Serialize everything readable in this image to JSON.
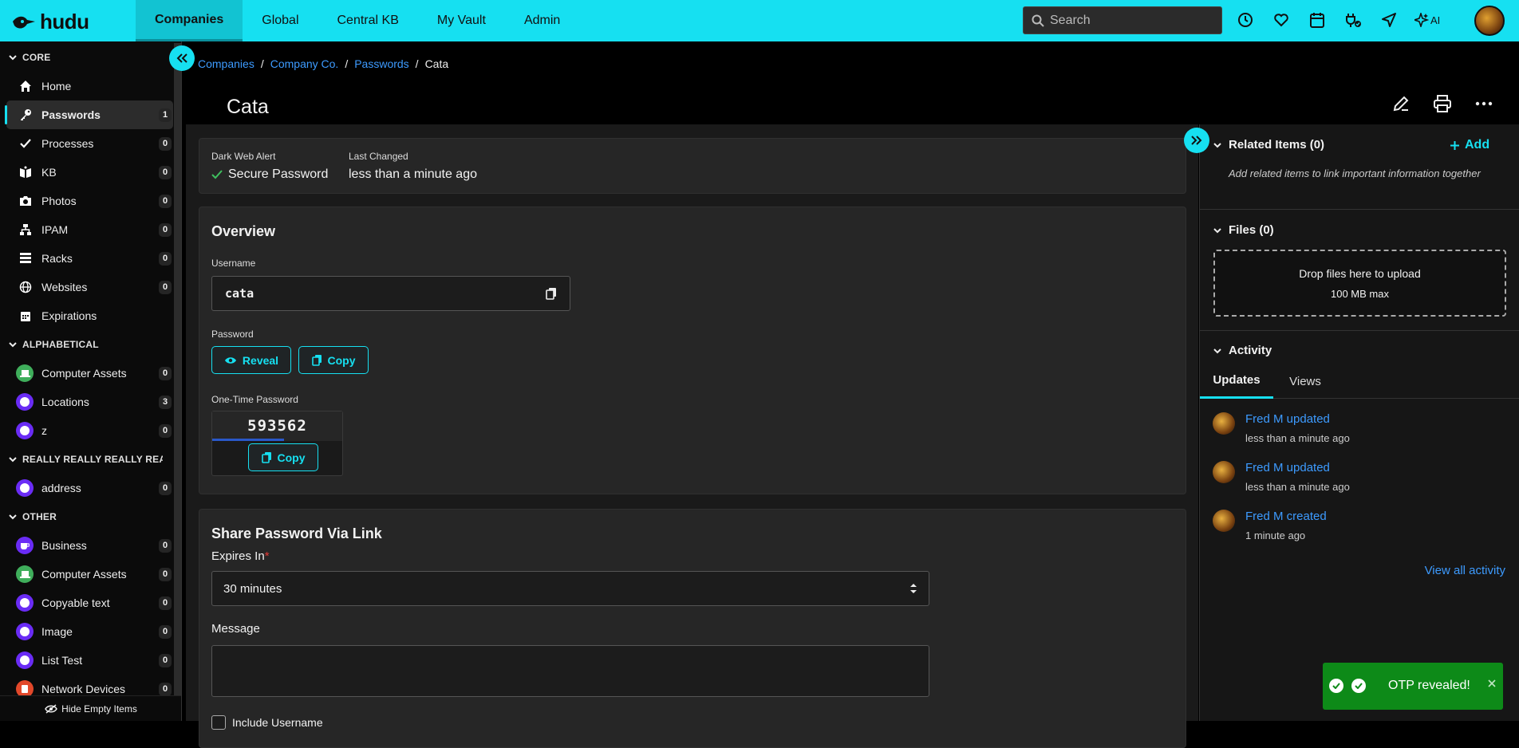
{
  "app": {
    "logo_text": "hudu"
  },
  "nav": {
    "items": [
      "Companies",
      "Global",
      "Central KB",
      "My Vault",
      "Admin"
    ],
    "active": "Companies"
  },
  "search": {
    "placeholder": "Search"
  },
  "topbar": {
    "ai_label": "AI"
  },
  "sidebar": {
    "sections": [
      {
        "title": "CORE"
      },
      {
        "title": "ALPHABETICAL"
      },
      {
        "title": "REALLY REALLY REALLY REALLY"
      },
      {
        "title": "OTHER"
      }
    ],
    "core": [
      {
        "label": "Home",
        "icon": "home-icon"
      },
      {
        "label": "Passwords",
        "count": "1",
        "icon": "key-icon"
      },
      {
        "label": "Processes",
        "count": "0",
        "icon": "check-icon"
      },
      {
        "label": "KB",
        "count": "0",
        "icon": "book-icon"
      },
      {
        "label": "Photos",
        "count": "0",
        "icon": "camera-icon"
      },
      {
        "label": "IPAM",
        "count": "0",
        "icon": "network-icon"
      },
      {
        "label": "Racks",
        "count": "0",
        "icon": "rack-icon"
      },
      {
        "label": "Websites",
        "count": "0",
        "icon": "globe-icon"
      },
      {
        "label": "Expirations",
        "icon": "calendar-icon"
      }
    ],
    "alphabetical": [
      {
        "label": "Computer Assets",
        "count": "0",
        "color": "#3fae5b"
      },
      {
        "label": "Locations",
        "count": "3",
        "color": "#6a2cf5"
      },
      {
        "label": "z",
        "count": "0",
        "color": "#6a2cf5"
      }
    ],
    "really": [
      {
        "label": "address",
        "count": "0",
        "color": "#6a2cf5"
      }
    ],
    "other": [
      {
        "label": "Business",
        "count": "0",
        "color": "#6a2cf5"
      },
      {
        "label": "Computer Assets",
        "count": "0",
        "color": "#3fae5b"
      },
      {
        "label": "Copyable text",
        "count": "0",
        "color": "#6a2cf5"
      },
      {
        "label": "Image",
        "count": "0",
        "color": "#6a2cf5"
      },
      {
        "label": "List Test",
        "count": "0",
        "color": "#6a2cf5"
      },
      {
        "label": "Network Devices",
        "count": "0",
        "color": "#e2482a"
      }
    ],
    "hide_empty": "Hide Empty Items"
  },
  "breadcrumb": {
    "items": [
      "Companies",
      "Company Co.",
      "Passwords"
    ],
    "current": "Cata",
    "separator": "/"
  },
  "page": {
    "title": "Cata"
  },
  "status_card": {
    "dark_web_label": "Dark Web Alert",
    "dark_web_value": "Secure Password",
    "last_changed_label": "Last Changed",
    "last_changed_value": "less than a minute ago"
  },
  "overview": {
    "title": "Overview",
    "username_label": "Username",
    "username_value": "cata",
    "password_label": "Password",
    "reveal_label": "Reveal",
    "copy_label": "Copy",
    "otp_label": "One-Time Password",
    "otp_code": "593562",
    "otp_progress": 0.55,
    "otp_copy_label": "Copy"
  },
  "share": {
    "title": "Share Password Via Link",
    "expires_label": "Expires In",
    "required_mark": "*",
    "expires_value": "30 minutes",
    "message_label": "Message",
    "include_username_label": "Include Username"
  },
  "related": {
    "title": "Related Items (0)",
    "add_label": "Add",
    "empty_text": "Add related items to link important information together"
  },
  "files": {
    "title": "Files (0)",
    "drop_text": "Drop files here to upload",
    "max_text": "100 MB max"
  },
  "activity": {
    "title": "Activity",
    "tabs": [
      "Updates",
      "Views"
    ],
    "active_tab": "Updates",
    "entries": [
      {
        "text": "Fred M updated",
        "time": "less than a minute ago"
      },
      {
        "text": "Fred M updated",
        "time": "less than a minute ago"
      },
      {
        "text": "Fred M created",
        "time": "1 minute ago"
      }
    ],
    "view_all": "View all activity"
  },
  "toast": {
    "message": "OTP revealed!"
  },
  "colors": {
    "accent": "#16e0f1",
    "link": "#3d9bff",
    "toast": "#0d8a18",
    "purple": "#6a2cf5",
    "green": "#3fae5b"
  }
}
